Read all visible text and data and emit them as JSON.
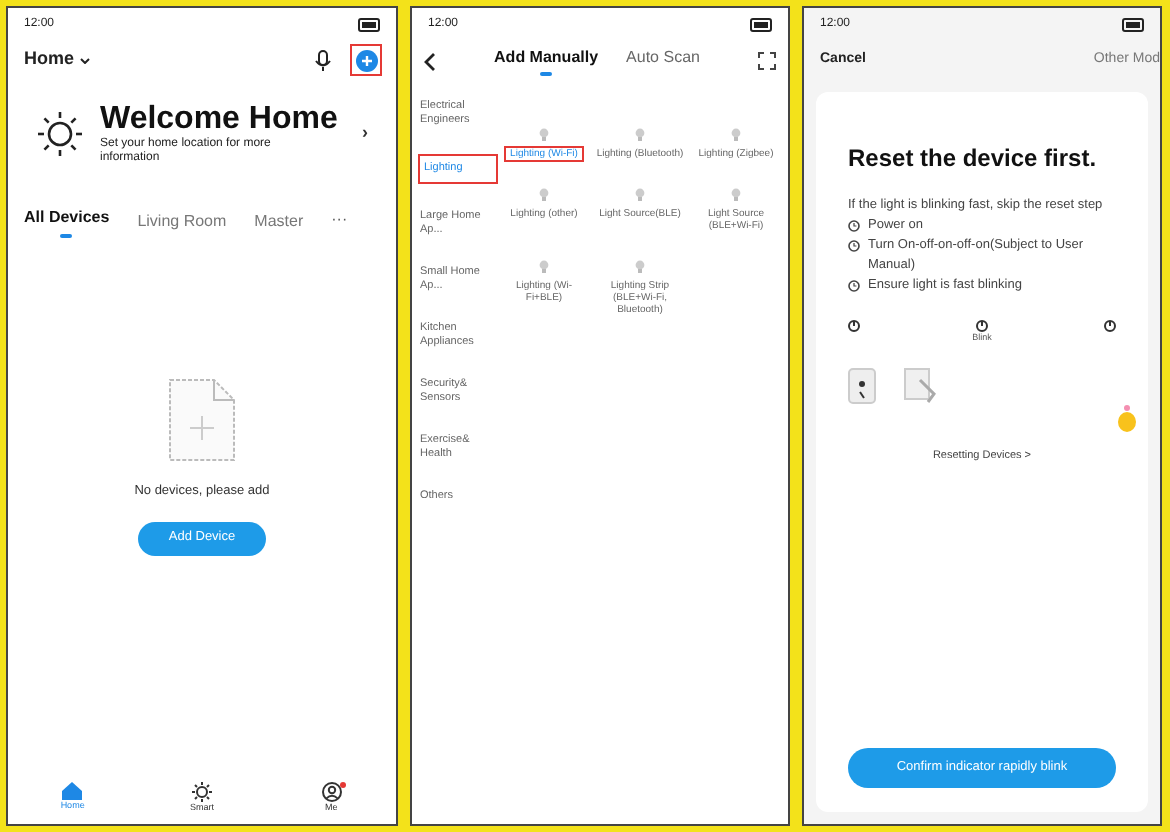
{
  "home_screen": {
    "status_bar": {
      "time": "12:00"
    },
    "home_menu": "Home",
    "add_highlighted": true,
    "welcome": {
      "title": "Welcome Home",
      "subtitle": "Set your home location for more information",
      "chevron": "›"
    },
    "tabs": [
      {
        "label": "All Devices",
        "selected": true
      },
      {
        "label": "Living Room",
        "selected": false
      },
      {
        "label": "Master",
        "selected": false
      }
    ],
    "more": "···",
    "empty_text": "No devices, please add",
    "add_button": "Add Device",
    "nav": [
      {
        "label": "Home",
        "kind": "home",
        "selected": true,
        "badge": false
      },
      {
        "label": "Smart",
        "kind": "smart",
        "selected": false,
        "badge": false
      },
      {
        "label": "Me",
        "kind": "me",
        "selected": false,
        "badge": true
      }
    ]
  },
  "add_screen": {
    "status_bar": {
      "time": "12:00"
    },
    "tabs": [
      {
        "label": "Add Manually",
        "selected": true
      },
      {
        "label": "Auto Scan",
        "selected": false
      }
    ],
    "categories": [
      {
        "label": "Electrical Engineers",
        "selected": false
      },
      {
        "label": "Lighting",
        "selected": true
      },
      {
        "label": "Large Home Ap...",
        "selected": false
      },
      {
        "label": "Small Home Ap...",
        "selected": false
      },
      {
        "label": "Kitchen Appliances",
        "selected": false
      },
      {
        "label": "Security& Sensors",
        "selected": false
      },
      {
        "label": "Exercise& Health",
        "selected": false
      },
      {
        "label": "Others",
        "selected": false
      }
    ],
    "devices": [
      {
        "label": "Lighting (Wi-Fi)",
        "selected": true
      },
      {
        "label": "Lighting (Bluetooth)",
        "selected": false
      },
      {
        "label": "Lighting (Zigbee)",
        "selected": false
      },
      {
        "label": "Lighting (other)",
        "selected": false
      },
      {
        "label": "Light Source(BLE)",
        "selected": false
      },
      {
        "label": "Light Source (BLE+Wi-Fi)",
        "selected": false
      },
      {
        "label": "Lighting (Wi-Fi+BLE)",
        "selected": false
      },
      {
        "label": "Lighting Strip (BLE+Wi-Fi, Bluetooth)",
        "selected": false
      }
    ]
  },
  "reset_screen": {
    "status_bar": {
      "time": "12:00"
    },
    "cancel": "Cancel",
    "other_mode": "Other Mod",
    "title": "Reset the device first.",
    "intro": "If the light is blinking fast, skip the reset step",
    "steps": [
      "Power on",
      "Turn On-off-on-off-on(Subject to User Manual)",
      "Ensure light is fast blinking"
    ],
    "step_label": "Blink",
    "resetting_link": "Resetting Devices >",
    "confirm_button": "Confirm indicator rapidly blink"
  }
}
